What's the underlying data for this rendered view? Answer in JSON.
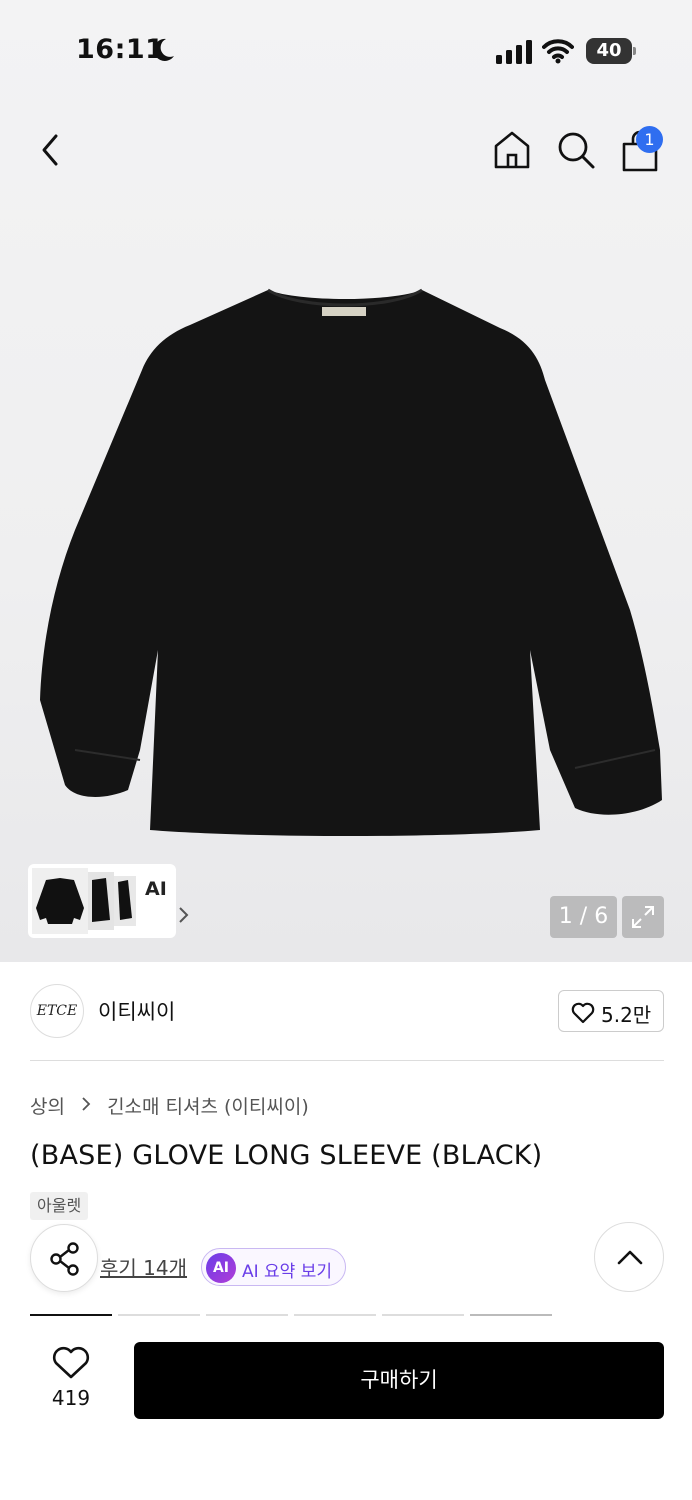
{
  "status_bar": {
    "time": "16:11",
    "battery": "40"
  },
  "header": {
    "cart_count": "1"
  },
  "gallery": {
    "ai_label": "AI",
    "page_counter": "1 / 6"
  },
  "brand": {
    "logo_text": "ETCE",
    "name": "이티씨이",
    "likes": "5.2만"
  },
  "product": {
    "breadcrumb": [
      "상의",
      "긴소매 티셔츠 (이티씨이)"
    ],
    "title": "(BASE) GLOVE LONG SLEEVE (BLACK)",
    "tag": "아울렛",
    "review_link": "후기 14개",
    "ai_summary_badge": "AI",
    "ai_summary_label": "AI 요약 보기"
  },
  "bottom_bar": {
    "wish_count": "419",
    "buy_label": "구매하기"
  },
  "colors": {
    "accent": "#2f6ef0",
    "ai_purple": "#6a3ee8",
    "buy_button": "#000000"
  }
}
